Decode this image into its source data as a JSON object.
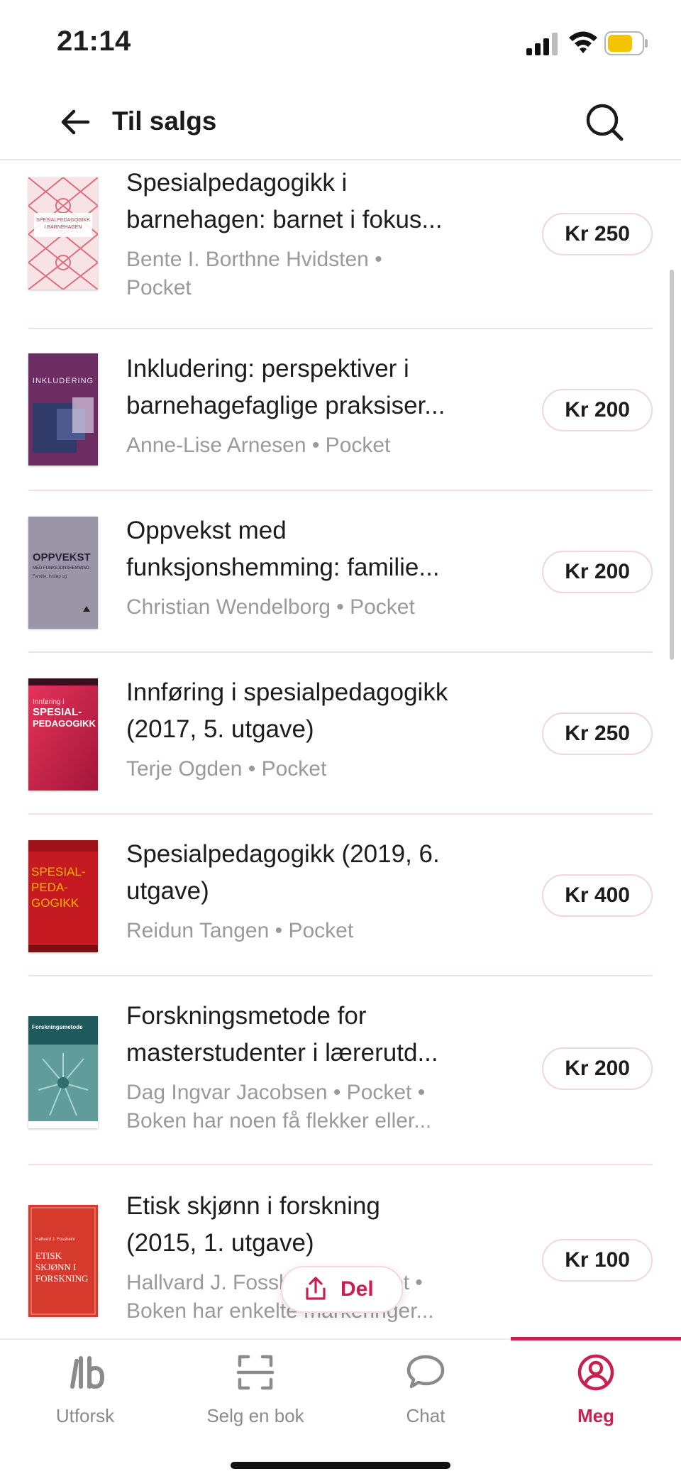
{
  "status_bar": {
    "time": "21:14"
  },
  "header": {
    "title": "Til salgs"
  },
  "books": [
    {
      "title_line1": "Spesialpedagogikk i",
      "title_line2": "barnehagen: barnet i fokus...",
      "meta_line1": "Bente I. Borthne Hvidsten •",
      "meta_line2": "Pocket",
      "price": "Kr 250",
      "cover_title": "SPESIALPEDAGOGIKK I BARNEHAGEN",
      "cover_color": "#f4d5d8"
    },
    {
      "title_line1": "Inkludering: perspektiver i",
      "title_line2": "barnehagefaglige praksiser...",
      "meta_line1": "Anne-Lise Arnesen • Pocket",
      "meta_line2": "",
      "price": "Kr 200",
      "cover_title": "INKLUDERING",
      "cover_color": "#6d2f63"
    },
    {
      "title_line1": "Oppvekst med",
      "title_line2": "funksjonshemming: familie...",
      "meta_line1": "Christian Wendelborg • Pocket",
      "meta_line2": "",
      "price": "Kr 200",
      "cover_title": "OPPVEKST",
      "cover_color": "#9b96a8"
    },
    {
      "title_line1": "Innføring i spesialpedagogikk",
      "title_line2": "(2017, 5. utgave)",
      "meta_line1": "Terje Ogden • Pocket",
      "meta_line2": "",
      "price": "Kr 250",
      "cover_title": "SPESIAL- PEDAGOGIKK",
      "cover_color": "#d62b4d"
    },
    {
      "title_line1": "Spesialpedagogikk (2019, 6.",
      "title_line2": "utgave)",
      "meta_line1": "Reidun Tangen • Pocket",
      "meta_line2": "",
      "price": "Kr 400",
      "cover_title": "SPESIAL- PEDA- GOGIKK",
      "cover_color": "#c81a22"
    },
    {
      "title_line1": "Forskningsmetode for",
      "title_line2": "masterstudenter i lærerutd...",
      "meta_line1": "Dag Ingvar Jacobsen • Pocket •",
      "meta_line2": "Boken har noen få flekker eller...",
      "price": "Kr 200",
      "cover_title": "Forskningsmetode",
      "cover_color": "#1f5a5c"
    },
    {
      "title_line1": "Etisk skjønn i forskning",
      "title_line2": "(2015, 1. utgave)",
      "meta_line1": "Hallvard J. Fossheim • Pocket •",
      "meta_line2": "Boken har enkelte markeringer...",
      "price": "Kr 100",
      "cover_title": "ETISK SKJØNN I FORSKNING",
      "cover_color": "#d63a2c"
    }
  ],
  "share": {
    "label": "Del"
  },
  "tabs": [
    {
      "label": "Utforsk",
      "icon": "lb-logo-icon"
    },
    {
      "label": "Selg en bok",
      "icon": "scan-icon"
    },
    {
      "label": "Chat",
      "icon": "chat-bubble-icon"
    },
    {
      "label": "Meg",
      "icon": "user-circle-icon"
    }
  ],
  "colors": {
    "accent": "#c8214f",
    "divider": "#f4dde4"
  }
}
